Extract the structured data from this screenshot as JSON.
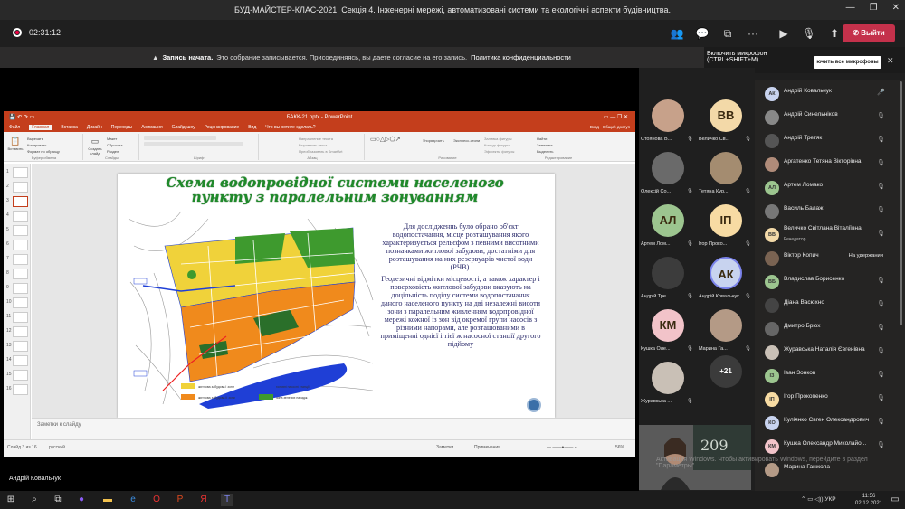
{
  "window": {
    "title": "БУД-МАЙСТЕР-КЛАС-2021. Секція 4. Інженерні мережі, автоматизовані системи та екологічні аспекти будівництва."
  },
  "call": {
    "timer": "02:31:12",
    "leave_label": "Выйти"
  },
  "notice": {
    "bold": "Запись начата.",
    "text": "Это собрание записывается. Присоединяясь, вы даете согласие на его запись.",
    "link": "Политика конфиденциальности"
  },
  "tooltip": {
    "line1": "Включить микрофон",
    "line2": "(CTRL+SHIFT+M)",
    "unmute_all": "ючить все микрофоны"
  },
  "ppt": {
    "file_title": "БАКК-21.pptx - PowerPoint",
    "login": "Вход",
    "share": "Общий доступ",
    "tabs": [
      "Файл",
      "Главная",
      "Вставка",
      "Дизайн",
      "Переходы",
      "Анимация",
      "Слайд-шоу",
      "Рецензирование",
      "Вид",
      "Что вы хотите сделать?"
    ],
    "groups": [
      "Буфер обмена",
      "Слайды",
      "Шрифт",
      "Абзац",
      "Рисование",
      "Редактирование"
    ],
    "clipboard": [
      "Вырезать",
      "Копировать",
      "Формат по образцу"
    ],
    "paste": "Вставить",
    "new_slide": "Создать слайд",
    "slides_menu": [
      "Макет",
      "Сбросить",
      "Раздел"
    ],
    "paragraph": [
      "Направление текста",
      "Выровнять текст",
      "Преобразовать в SmartArt"
    ],
    "drawing": [
      "Упорядочить",
      "Экспресс-стили"
    ],
    "drawing_effects": [
      "Заливка фигуры",
      "Контур фигуры",
      "Эффекты фигуры"
    ],
    "editing": [
      "Найти",
      "Заменить",
      "Выделить"
    ],
    "slide_nums": [
      "1",
      "2",
      "3",
      "4",
      "5",
      "6",
      "7",
      "8",
      "9",
      "10",
      "11",
      "12",
      "13",
      "14",
      "15",
      "16"
    ],
    "notes_placeholder": "Заметки к слайду",
    "status_left": "Слайд 3 из 16",
    "status_lang": "русский",
    "status_notes": "Заметки",
    "status_comments": "Примечания",
    "zoom": "56%"
  },
  "slide": {
    "title": "Схема водопровідної системи населеного пункту з паралельним зонуванням",
    "para1": "Для дослідженнь було обрано об'єкт водопостачання, місце розташування якого характеризується рельєфом з певними висотними позначками житлової забудови, достатніми для розташування на них резервуарів чистої води (РЧВ).",
    "para2": "Геодезичні відмітки місцевості, а також характер і поверховість житлової забудови вказують на доцільність поділу системи водопостачання даного населеного пункту на дві незалежні висоти зони з паралельним живленням водопровідної мережі кожної із зон від окремої групи насосів з різними напорами, але розташованими в приміщенні однієї і тієї ж насосної станції другого підйому",
    "legend": [
      "житлова забудова І зони",
      "житлова забудова ІІ зони",
      "головні насосні станції",
      "зона зелених насадж."
    ],
    "colors": {
      "title": "#1f8a2a",
      "zone1": "#f0c020",
      "zone2": "#f08a1c",
      "green": "#3e9a2e",
      "water": "#1f3fd6"
    }
  },
  "presenter": "Андрій Ковальчук",
  "tiles": [
    {
      "name": "Стоянова В...",
      "initials": "",
      "color": "#c7a18a"
    },
    {
      "name": "Величко Св...",
      "initials": "BB",
      "color": "#f3d9a8"
    },
    {
      "name": "Олексій Со...",
      "initials": "",
      "color": "#6a6a6a"
    },
    {
      "name": "Тетяна Кур...",
      "initials": "",
      "color": "#a48c70"
    },
    {
      "name": "Артем Лом...",
      "initials": "АЛ",
      "color": "#9cc58f"
    },
    {
      "name": "Ігор Проко...",
      "initials": "ІП",
      "color": "#f7dba3"
    },
    {
      "name": "Андрій Тре...",
      "initials": "",
      "color": "#3c3c3c"
    },
    {
      "name": "Андрій Ковальчук",
      "initials": "АК",
      "color": "#c8d3ef"
    },
    {
      "name": "Кушка Оле...",
      "initials": "КМ",
      "color": "#f2c3c9"
    },
    {
      "name": "Марина Га...",
      "initials": "",
      "color": "#b49a86"
    },
    {
      "name": "Журавська ...",
      "initials": "",
      "color": "#c9c0b6"
    }
  ],
  "more_count": "+21",
  "participants": [
    {
      "name": "Андрій Ковальчук",
      "initials": "АК",
      "color": "#c8d3ef",
      "sub": "",
      "status": "mic"
    },
    {
      "name": "Андрій Синельніков",
      "initials": "",
      "color": "#888",
      "sub": "",
      "status": "muted"
    },
    {
      "name": "Андрій Третяк",
      "initials": "",
      "color": "#555",
      "sub": "",
      "status": "muted"
    },
    {
      "name": "Аргатенко Тетяна Вікторівна",
      "initials": "",
      "color": "#b08b79",
      "sub": "",
      "status": "muted"
    },
    {
      "name": "Артем Ломако",
      "initials": "АЛ",
      "color": "#9cc58f",
      "sub": "",
      "status": "muted"
    },
    {
      "name": "Василь Балаж",
      "initials": "",
      "color": "#777",
      "sub": "",
      "status": "muted"
    },
    {
      "name": "Величко Світлана Віталіївна",
      "initials": "ВВ",
      "color": "#f3d9a8",
      "sub": "Речедатор",
      "status": "muted"
    },
    {
      "name": "Віктор Копич",
      "initials": "",
      "color": "#7a6352",
      "sub": "",
      "status": "hold"
    },
    {
      "name": "Владислав Борисенко",
      "initials": "ВБ",
      "color": "#9cc58f",
      "sub": "",
      "status": "muted"
    },
    {
      "name": "Діана Васюхно",
      "initials": "",
      "color": "#444",
      "sub": "",
      "status": "muted"
    },
    {
      "name": "Дмитро Брюх",
      "initials": "",
      "color": "#666",
      "sub": "",
      "status": "muted"
    },
    {
      "name": "Журавська Наталія Євгенівна",
      "initials": "",
      "color": "#c9c0b6",
      "sub": "",
      "status": "muted"
    },
    {
      "name": "Іван Зонков",
      "initials": "ІЗ",
      "color": "#9cc58f",
      "sub": "",
      "status": "muted"
    },
    {
      "name": "Ігор Прокопенко",
      "initials": "ІП",
      "color": "#f7dba3",
      "sub": "",
      "status": "muted"
    },
    {
      "name": "Куліянко Євген Олександрович",
      "initials": "КО",
      "color": "#c8d3ef",
      "sub": "",
      "status": "muted"
    },
    {
      "name": "Кушка Олександр Миколайо...",
      "initials": "КМ",
      "color": "#f2c3c9",
      "sub": "",
      "status": "muted"
    },
    {
      "name": "Марина Ганжола",
      "initials": "",
      "color": "#b49a86",
      "sub": "",
      "status": ""
    }
  ],
  "hold_label": "На удержании",
  "windows_notice": "Активация Windows. Чтобы активировать Windows, перейдите в раздел \"Параметры\".",
  "taskbar": {
    "lang": "УКР",
    "time": "11:56",
    "date": "02.12.2021"
  }
}
